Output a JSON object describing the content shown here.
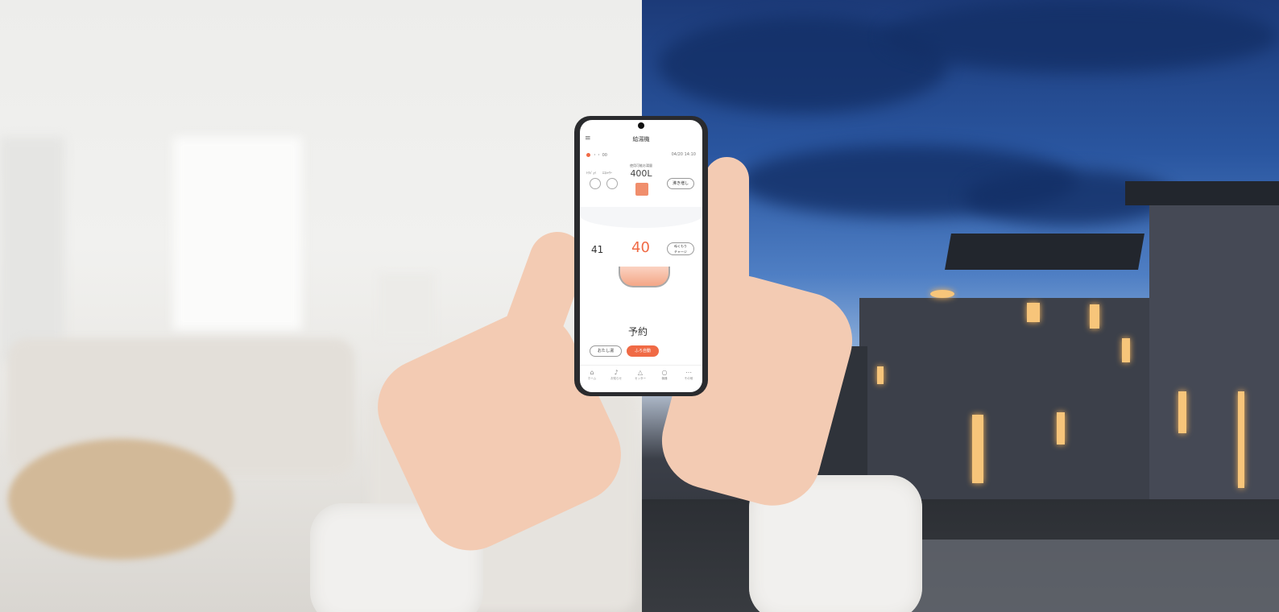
{
  "app": {
    "title": "給湯機",
    "menu_icon": "menu-icon",
    "status_text": "・・ 00",
    "time_text": "04/20 14:10"
  },
  "tank": {
    "label_left1": "ﾄｸｼﾞｮｲ",
    "label_left2": "ｴｺｼｬﾜｰ",
    "capacity_label": "使用可能お湯量",
    "capacity_value": "400L",
    "button": "沸き増し"
  },
  "bath": {
    "current_temp": "41",
    "set_temp": "40",
    "button": "ぬくもり\nチャージ"
  },
  "schedule": {
    "label": "予約",
    "button_left": "おたし湯",
    "button_right": "ふろ自動"
  },
  "nav": [
    {
      "label": "ホーム",
      "icon": "home-icon"
    },
    {
      "label": "お知らせ",
      "icon": "bell-icon"
    },
    {
      "label": "セッター",
      "icon": "house-icon"
    },
    {
      "label": "機器",
      "icon": "search-icon"
    },
    {
      "label": "その他",
      "icon": "more-icon"
    }
  ]
}
